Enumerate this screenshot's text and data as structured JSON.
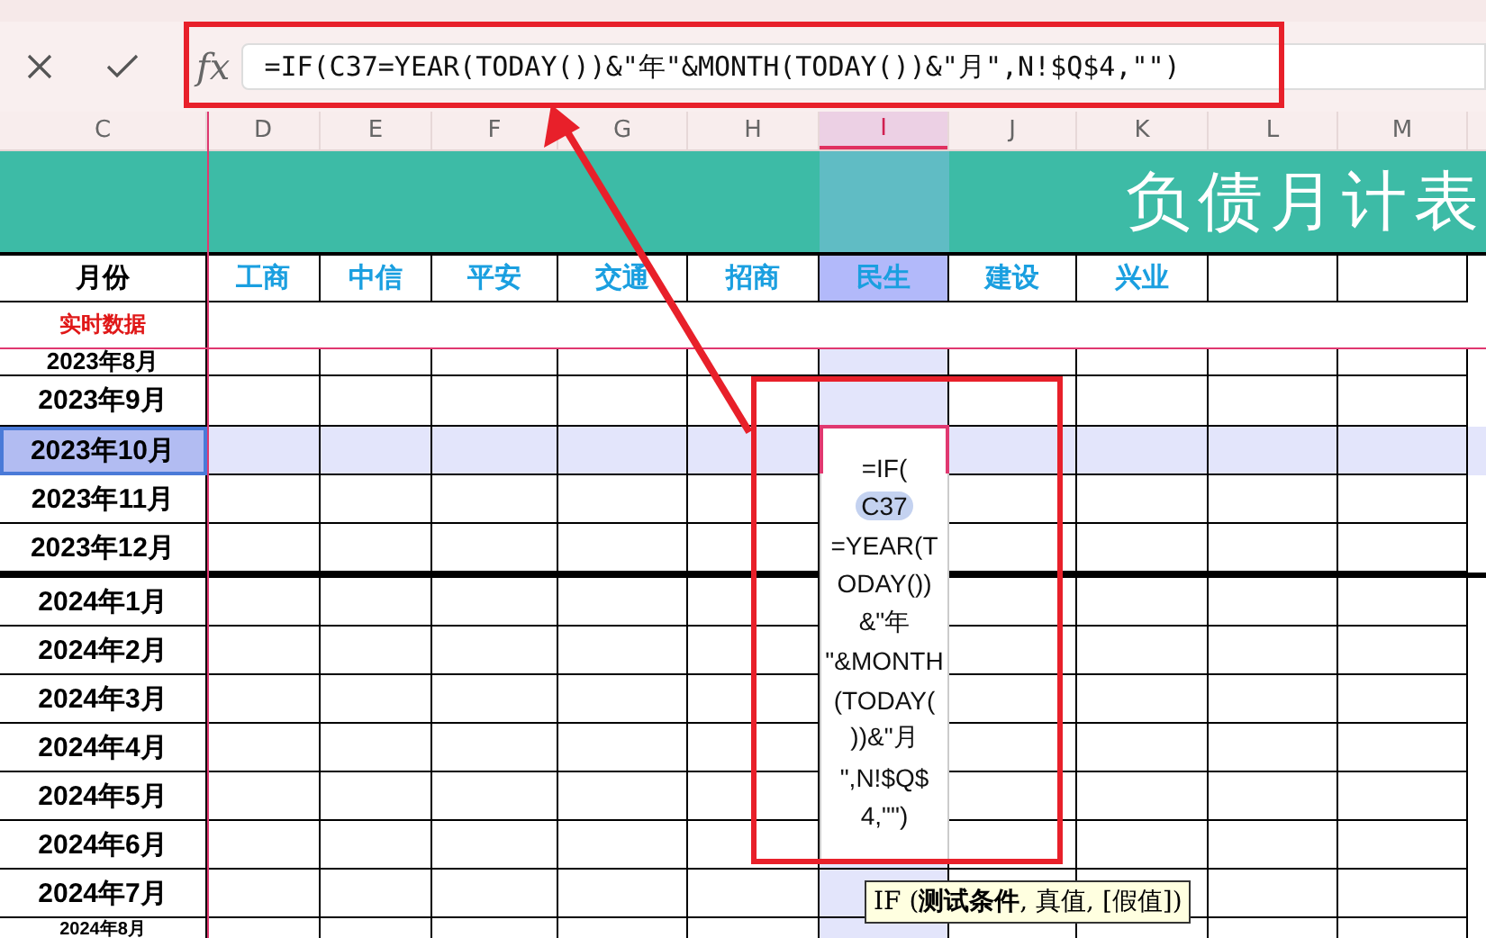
{
  "formula_bar": {
    "fx": "fx",
    "formula": "=IF(C37=YEAR(TODAY())&\"年\"&MONTH(TODAY())&\"月\",N!$Q$4,\"\")"
  },
  "columns": [
    {
      "label": "C",
      "selected": false
    },
    {
      "label": "D",
      "selected": false
    },
    {
      "label": "E",
      "selected": false
    },
    {
      "label": "F",
      "selected": false
    },
    {
      "label": "G",
      "selected": false
    },
    {
      "label": "H",
      "selected": false
    },
    {
      "label": "I",
      "selected": true
    },
    {
      "label": "J",
      "selected": false
    },
    {
      "label": "K",
      "selected": false
    },
    {
      "label": "L",
      "selected": false
    },
    {
      "label": "M",
      "selected": false
    }
  ],
  "banner": {
    "title": "负债月计表"
  },
  "header_row": {
    "label": "月份",
    "banks": [
      {
        "name": "工商",
        "selected": false
      },
      {
        "name": "中信",
        "selected": false
      },
      {
        "name": "平安",
        "selected": false
      },
      {
        "name": "交通",
        "selected": false
      },
      {
        "name": "招商",
        "selected": false
      },
      {
        "name": "民生",
        "selected": true
      },
      {
        "name": "建设",
        "selected": false
      },
      {
        "name": "兴业",
        "selected": false
      }
    ]
  },
  "subheader": "实时数据",
  "rows": [
    {
      "month": "2023年8月",
      "selected": false
    },
    {
      "month": "2023年9月",
      "selected": false
    },
    {
      "month": "2023年10月",
      "selected": true
    },
    {
      "month": "2023年11月",
      "selected": false
    },
    {
      "month": "2023年12月",
      "selected": false
    },
    {
      "month": "2024年1月",
      "selected": false
    },
    {
      "month": "2024年2月",
      "selected": false
    },
    {
      "month": "2024年3月",
      "selected": false
    },
    {
      "month": "2024年4月",
      "selected": false
    },
    {
      "month": "2024年5月",
      "selected": false
    },
    {
      "month": "2024年6月",
      "selected": false
    },
    {
      "month": "2024年7月",
      "selected": false
    },
    {
      "month": "2024年8月",
      "selected": false
    }
  ],
  "editor": {
    "lines": [
      {
        "text": "=IF(",
        "kind": "plain"
      },
      {
        "text": "C37",
        "kind": "ref"
      },
      {
        "text": "=YEAR(T",
        "kind": "plain"
      },
      {
        "text": "ODAY())",
        "kind": "plain"
      },
      {
        "text": "&\"年",
        "kind": "plain"
      },
      {
        "text": "\"&MONTH",
        "kind": "plain"
      },
      {
        "text": "(TODAY(",
        "kind": "plain"
      },
      {
        "text": "))&\"月",
        "kind": "plain"
      },
      {
        "text": "\",N!$Q$",
        "kind": "plain"
      },
      {
        "text": "4,\"\")",
        "kind": "plain"
      }
    ]
  },
  "tooltip": "IF (**测试条件**, 真值, [假值])"
}
